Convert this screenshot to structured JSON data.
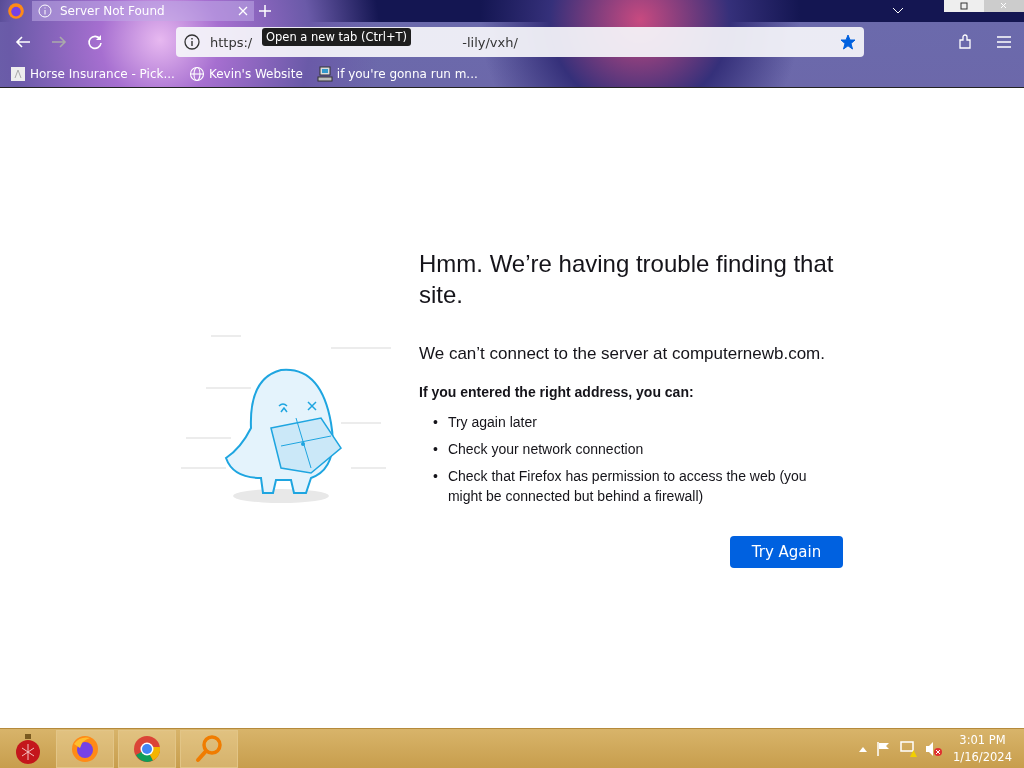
{
  "browser": {
    "tabs": [
      {
        "title": "Server Not Found",
        "selected": true
      }
    ],
    "tooltip": "Open a new tab (Ctrl+T)",
    "address": {
      "start": "https:/",
      "end": "-lily/vxh/",
      "bookmarked": true
    },
    "bookmarks": [
      {
        "label": "Horse Insurance - Pick...",
        "kind": "page"
      },
      {
        "label": "Kevin's Website",
        "kind": "globe"
      },
      {
        "label": "if you're gonna run m...",
        "kind": "computer"
      }
    ]
  },
  "error_page": {
    "title": "Hmm. We’re having trouble finding that site.",
    "message": "We can’t connect to the server at computernewb.com.",
    "subtitle": "If you entered the right address, you can:",
    "bullet": "•",
    "tips": [
      "Try again later",
      "Check your network connection",
      "Check that Firefox has permission to access the web (you might be connected but behind a firewall)"
    ],
    "button": "Try Again"
  },
  "taskbar": {
    "apps": [
      {
        "kind": "firefox"
      },
      {
        "kind": "chrome"
      },
      {
        "kind": "search"
      }
    ],
    "time": "3:01 PM",
    "date": "1/16/2024"
  }
}
